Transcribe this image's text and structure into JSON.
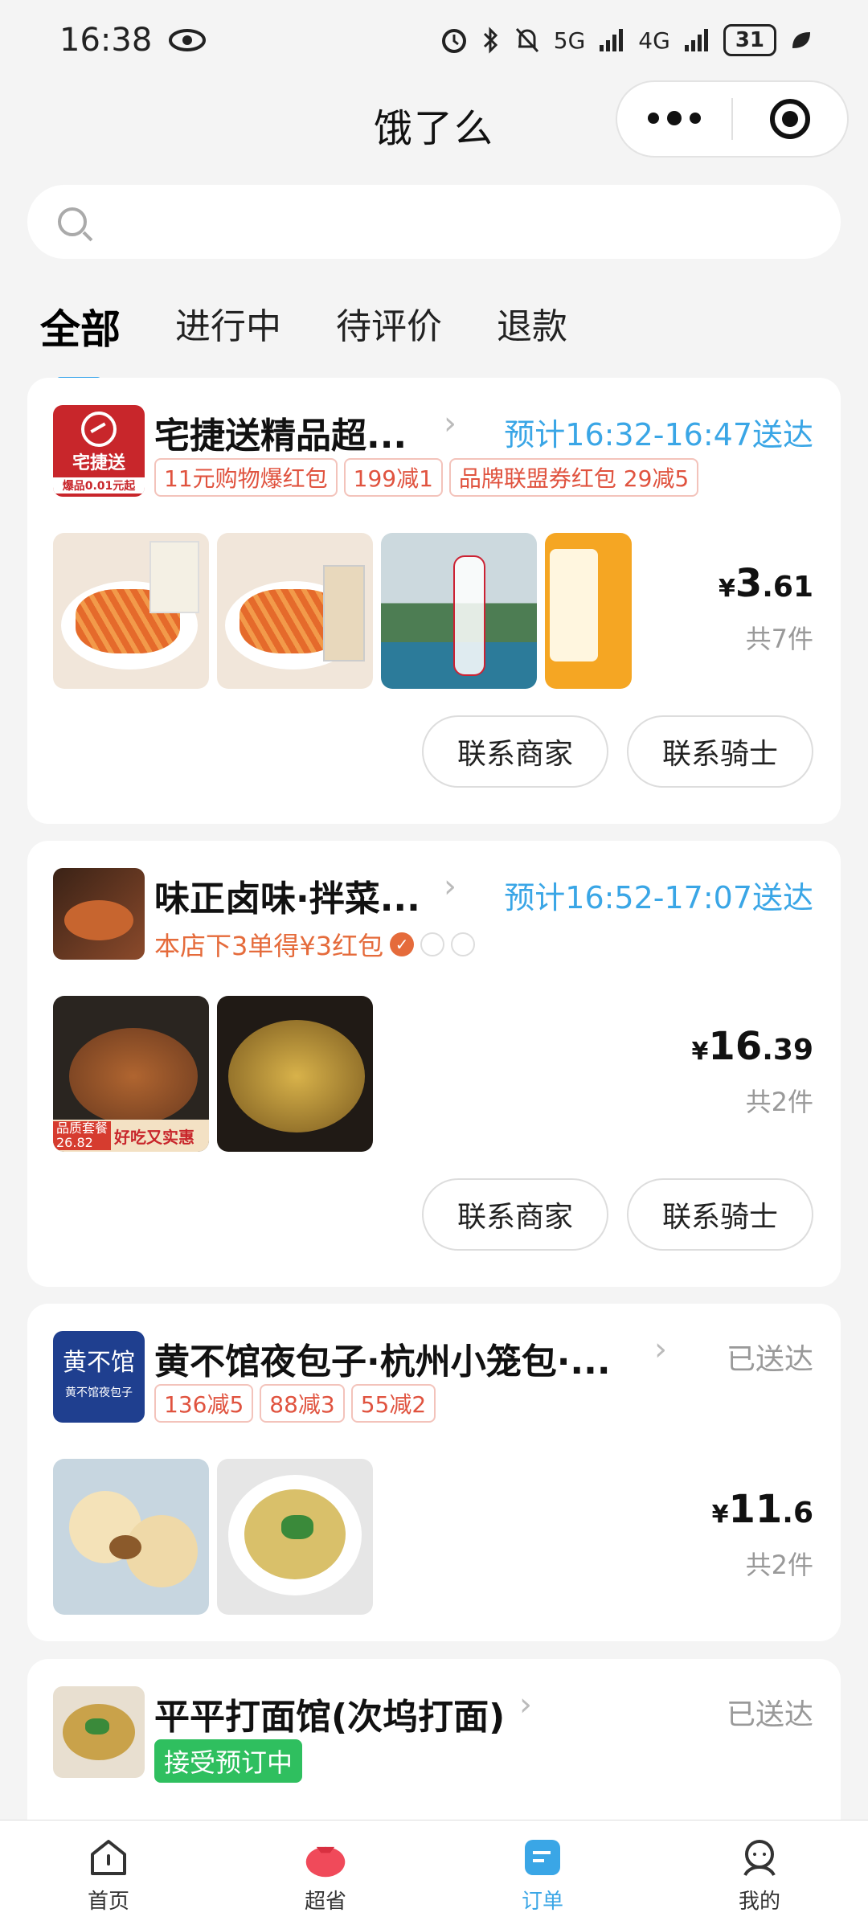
{
  "status": {
    "time": "16:38",
    "net1": "5G",
    "net2": "4G",
    "battery": "31"
  },
  "header": {
    "title": "饿了么"
  },
  "search": {
    "placeholder": ""
  },
  "tabs": [
    {
      "label": "全部"
    },
    {
      "label": "进行中"
    },
    {
      "label": "待评价"
    },
    {
      "label": "退款"
    }
  ],
  "orders": [
    {
      "shop": "宅捷送精品超...",
      "logo_text": "宅捷送",
      "logo_sub": "爆品0.01元起",
      "eta": "预计16:32-16:47送达",
      "tags": [
        "11元购物爆红包",
        "199减1",
        "品牌联盟券红包 29减5"
      ],
      "price_yuan": "¥",
      "price_int": "3",
      "price_dec": ".61",
      "count": "共7件",
      "btn_merchant": "联系商家",
      "btn_rider": "联系骑士"
    },
    {
      "shop": "味正卤味·拌菜...",
      "eta": "预计16:52-17:07送达",
      "promo": "本店下3单得¥3红包",
      "img_badge1": "品质套餐",
      "img_badge2": "26.82",
      "img_badge3": "好吃又实惠",
      "price_yuan": "¥",
      "price_int": "16",
      "price_dec": ".39",
      "count": "共2件",
      "btn_merchant": "联系商家",
      "btn_rider": "联系骑士"
    },
    {
      "shop": "黄不馆夜包子·杭州小笼包·...",
      "logo_text": "黄不馆",
      "logo_sub": "黄不馆夜包子",
      "status": "已送达",
      "tags": [
        "136减5",
        "88减3",
        "55减2"
      ],
      "price_yuan": "¥",
      "price_int": "11",
      "price_dec": ".6",
      "count": "共2件"
    },
    {
      "shop": "平平打面馆(次坞打面)",
      "status": "已送达",
      "badge": "接受预订中"
    }
  ],
  "nav": [
    {
      "label": "首页",
      "icon": "home-icon"
    },
    {
      "label": "超省",
      "icon": "red-bag-icon"
    },
    {
      "label": "订单",
      "icon": "order-icon"
    },
    {
      "label": "我的",
      "icon": "profile-icon"
    }
  ],
  "colors": {
    "accent": "#3aa6e6",
    "tag": "#e0533f",
    "green": "#2fbf5f"
  }
}
